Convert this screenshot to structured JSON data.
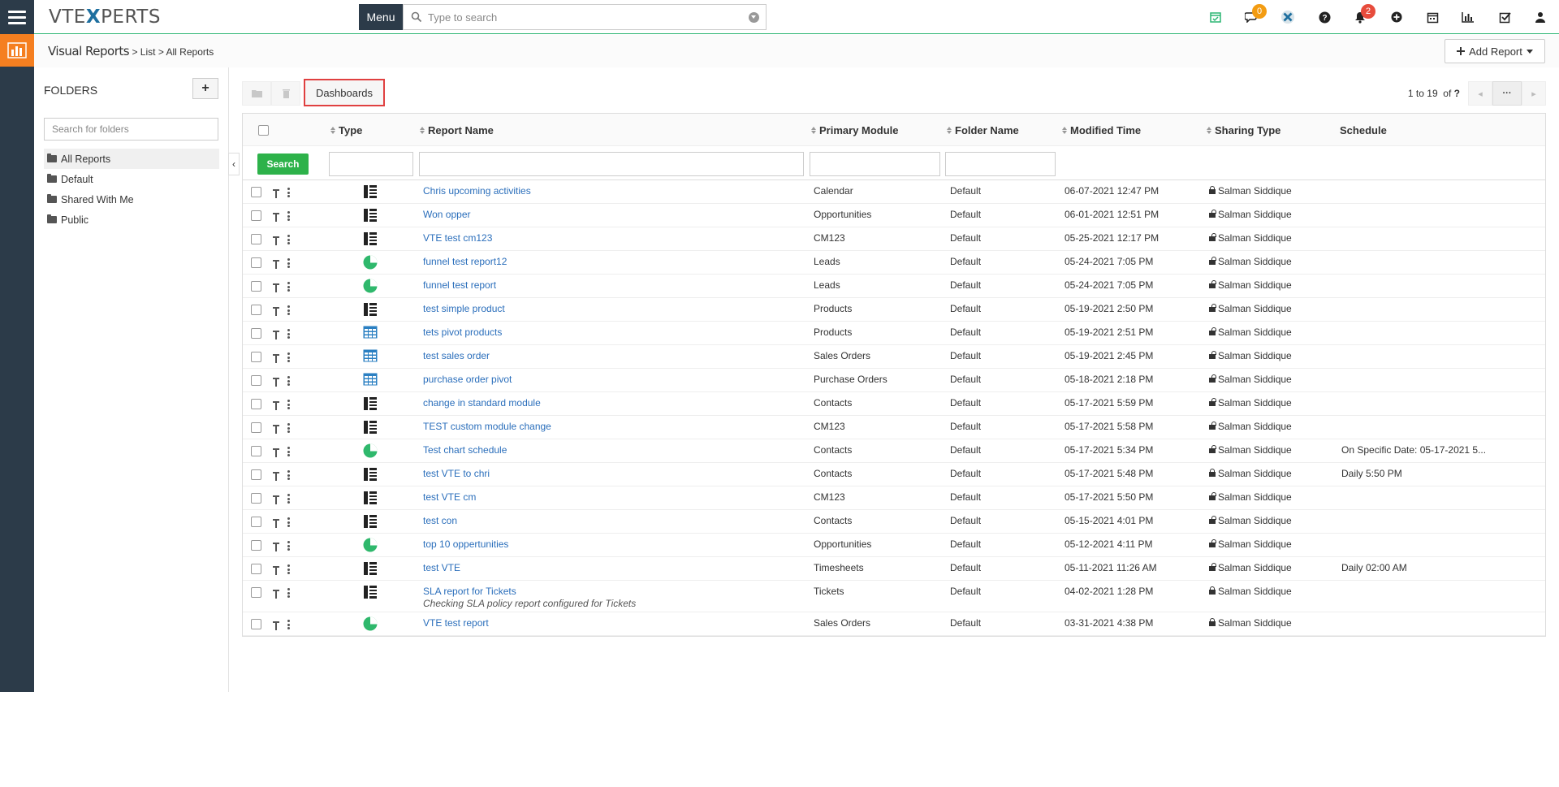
{
  "header": {
    "logo_prefix": "VTE",
    "logo_x": "X",
    "logo_suffix": "PERTS",
    "menu_label": "Menu",
    "search_placeholder": "Type to search",
    "chat_badge": "0",
    "notification_badge": "2",
    "colors": {
      "chat_badge": "#f39c12",
      "notification_badge": "#e74c3c",
      "accent_green": "#2bb673"
    }
  },
  "breadcrumb": {
    "module": "Visual Reports",
    "sep1": ">",
    "list": "List",
    "sep2": ">",
    "current": "All Reports"
  },
  "add_report_label": "Add Report",
  "sidebar": {
    "title": "FOLDERS",
    "add_label": "+",
    "search_placeholder": "Search for folders",
    "folders": [
      {
        "label": "All Reports",
        "active": true
      },
      {
        "label": "Default"
      },
      {
        "label": "Shared With Me"
      },
      {
        "label": "Public"
      }
    ]
  },
  "toolbar": {
    "dashboards_label": "Dashboards",
    "paging_range": "1 to 19",
    "paging_of": "of",
    "paging_total": "?",
    "paging_more": "···"
  },
  "table": {
    "columns": {
      "type": "Type",
      "report_name": "Report Name",
      "primary_module": "Primary Module",
      "folder_name": "Folder Name",
      "modified_time": "Modified Time",
      "sharing_type": "Sharing Type",
      "schedule": "Schedule"
    },
    "search_label": "Search",
    "rows": [
      {
        "type": "detail",
        "name": "Chris upcoming activities",
        "desc": "",
        "module": "Calendar",
        "folder": "Default",
        "modified": "06-07-2021 12:47 PM",
        "lock": "closed",
        "sharing": "Salman Siddique",
        "schedule": ""
      },
      {
        "type": "detail",
        "name": "Won opper",
        "desc": "",
        "module": "Opportunities",
        "folder": "Default",
        "modified": "06-01-2021 12:51 PM",
        "lock": "open",
        "sharing": "Salman Siddique",
        "schedule": ""
      },
      {
        "type": "detail",
        "name": "VTE test cm123",
        "desc": "",
        "module": "CM123",
        "folder": "Default",
        "modified": "05-25-2021 12:17 PM",
        "lock": "open",
        "sharing": "Salman Siddique",
        "schedule": ""
      },
      {
        "type": "chart",
        "name": "funnel test report12",
        "desc": "",
        "module": "Leads",
        "folder": "Default",
        "modified": "05-24-2021 7:05 PM",
        "lock": "open",
        "sharing": "Salman Siddique",
        "schedule": ""
      },
      {
        "type": "chart",
        "name": "funnel test report",
        "desc": "",
        "module": "Leads",
        "folder": "Default",
        "modified": "05-24-2021 7:05 PM",
        "lock": "open",
        "sharing": "Salman Siddique",
        "schedule": ""
      },
      {
        "type": "detail",
        "name": "test simple product",
        "desc": "",
        "module": "Products",
        "folder": "Default",
        "modified": "05-19-2021 2:50 PM",
        "lock": "open",
        "sharing": "Salman Siddique",
        "schedule": ""
      },
      {
        "type": "pivot",
        "name": "tets pivot products",
        "desc": "",
        "module": "Products",
        "folder": "Default",
        "modified": "05-19-2021 2:51 PM",
        "lock": "open",
        "sharing": "Salman Siddique",
        "schedule": ""
      },
      {
        "type": "pivot",
        "name": "test sales order",
        "desc": "",
        "module": "Sales Orders",
        "folder": "Default",
        "modified": "05-19-2021 2:45 PM",
        "lock": "open",
        "sharing": "Salman Siddique",
        "schedule": ""
      },
      {
        "type": "pivot",
        "name": "purchase order pivot",
        "desc": "",
        "module": "Purchase Orders",
        "folder": "Default",
        "modified": "05-18-2021 2:18 PM",
        "lock": "open",
        "sharing": "Salman Siddique",
        "schedule": ""
      },
      {
        "type": "detail",
        "name": "change in standard module",
        "desc": "",
        "module": "Contacts",
        "folder": "Default",
        "modified": "05-17-2021 5:59 PM",
        "lock": "open",
        "sharing": "Salman Siddique",
        "schedule": ""
      },
      {
        "type": "detail",
        "name": "TEST custom module change",
        "desc": "",
        "module": "CM123",
        "folder": "Default",
        "modified": "05-17-2021 5:58 PM",
        "lock": "open",
        "sharing": "Salman Siddique",
        "schedule": ""
      },
      {
        "type": "chart",
        "name": "Test chart schedule",
        "desc": "",
        "module": "Contacts",
        "folder": "Default",
        "modified": "05-17-2021 5:34 PM",
        "lock": "open",
        "sharing": "Salman Siddique",
        "schedule": "On Specific Date: 05-17-2021 5..."
      },
      {
        "type": "detail",
        "name": "test VTE to chri",
        "desc": "",
        "module": "Contacts",
        "folder": "Default",
        "modified": "05-17-2021 5:48 PM",
        "lock": "closed",
        "sharing": "Salman Siddique",
        "schedule": "Daily 5:50 PM"
      },
      {
        "type": "detail",
        "name": "test VTE cm",
        "desc": "",
        "module": "CM123",
        "folder": "Default",
        "modified": "05-17-2021 5:50 PM",
        "lock": "open",
        "sharing": "Salman Siddique",
        "schedule": ""
      },
      {
        "type": "detail",
        "name": "test con",
        "desc": "",
        "module": "Contacts",
        "folder": "Default",
        "modified": "05-15-2021 4:01 PM",
        "lock": "open",
        "sharing": "Salman Siddique",
        "schedule": ""
      },
      {
        "type": "chart",
        "name": "top 10 oppertunities",
        "desc": "",
        "module": "Opportunities",
        "folder": "Default",
        "modified": "05-12-2021 4:11 PM",
        "lock": "open",
        "sharing": "Salman Siddique",
        "schedule": ""
      },
      {
        "type": "detail",
        "name": "test VTE",
        "desc": "",
        "module": "Timesheets",
        "folder": "Default",
        "modified": "05-11-2021 11:26 AM",
        "lock": "open",
        "sharing": "Salman Siddique",
        "schedule": "Daily 02:00 AM"
      },
      {
        "type": "detail",
        "name": "SLA report for Tickets",
        "desc": "Checking SLA policy report configured for Tickets",
        "module": "Tickets",
        "folder": "Default",
        "modified": "04-02-2021 1:28 PM",
        "lock": "closed",
        "sharing": "Salman Siddique",
        "schedule": ""
      },
      {
        "type": "chart",
        "name": "VTE test report",
        "desc": "",
        "module": "Sales Orders",
        "folder": "Default",
        "modified": "03-31-2021 4:38 PM",
        "lock": "closed",
        "sharing": "Salman Siddique",
        "schedule": ""
      }
    ]
  }
}
